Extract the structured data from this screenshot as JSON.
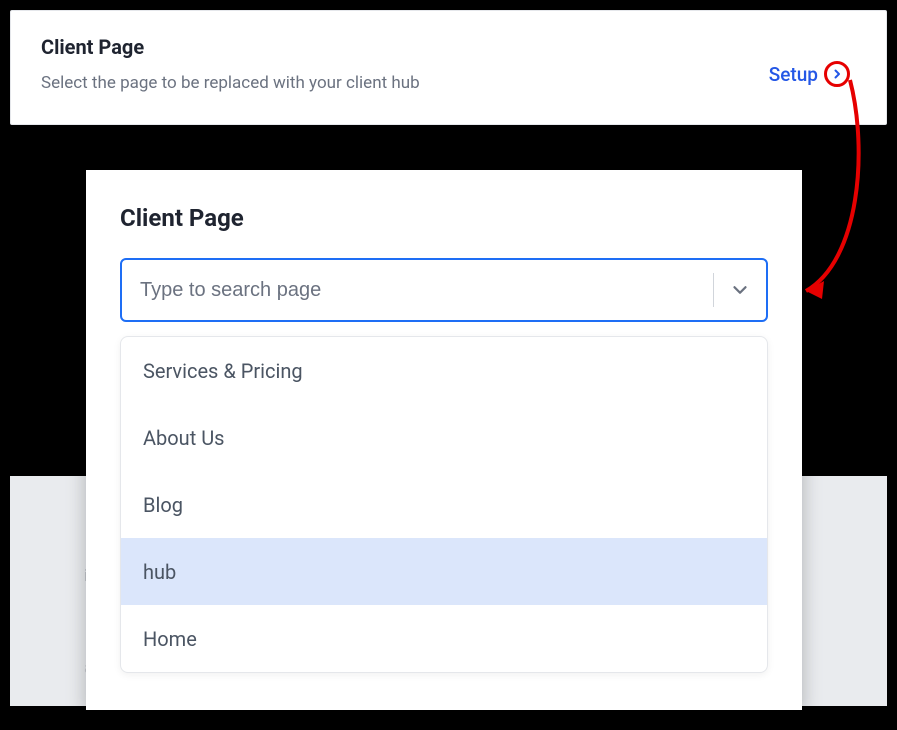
{
  "topbar": {
    "title": "Client Page",
    "subtitle": "Select the page to be replaced with your client hub",
    "setup_label": "Setup"
  },
  "modal": {
    "title": "Client Page",
    "search_placeholder": "Type to search page",
    "options": [
      {
        "label": "Services & Pricing",
        "highlighted": false
      },
      {
        "label": "About Us",
        "highlighted": false
      },
      {
        "label": "Blog",
        "highlighted": false
      },
      {
        "label": "hub",
        "highlighted": true
      },
      {
        "label": "Home",
        "highlighted": false
      }
    ]
  },
  "backdrop": {
    "faint1": "io",
    "faint2": "ad"
  }
}
